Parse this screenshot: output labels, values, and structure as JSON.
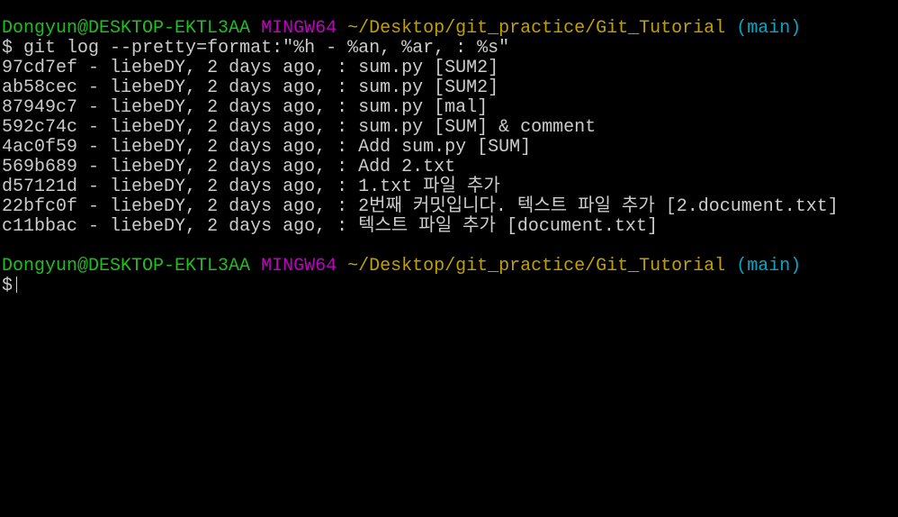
{
  "prompt": {
    "user_host": "Dongyun@DESKTOP-EKTL3AA",
    "system": "MINGW64",
    "path": "~/Desktop/git_practice/Git_Tutorial",
    "branch": "(main)",
    "symbol": "$"
  },
  "command": "git log --pretty=format:\"%h - %an, %ar, : %s\"",
  "log": [
    {
      "hash": "97cd7ef",
      "author": "liebeDY",
      "time": "2 days ago",
      "message": "sum.py [SUM2]"
    },
    {
      "hash": "ab58cec",
      "author": "liebeDY",
      "time": "2 days ago",
      "message": "sum.py [SUM2]"
    },
    {
      "hash": "87949c7",
      "author": "liebeDY",
      "time": "2 days ago",
      "message": "sum.py [mal]"
    },
    {
      "hash": "592c74c",
      "author": "liebeDY",
      "time": "2 days ago",
      "message": "sum.py [SUM] & comment"
    },
    {
      "hash": "4ac0f59",
      "author": "liebeDY",
      "time": "2 days ago",
      "message": "Add sum.py [SUM]"
    },
    {
      "hash": "569b689",
      "author": "liebeDY",
      "time": "2 days ago",
      "message": "Add 2.txt"
    },
    {
      "hash": "d57121d",
      "author": "liebeDY",
      "time": "2 days ago",
      "message": "1.txt 파일 추가"
    },
    {
      "hash": "22bfc0f",
      "author": "liebeDY",
      "time": "2 days ago",
      "message": "2번째 커밋입니다. 텍스트 파일 추가 [2.document.txt]"
    },
    {
      "hash": "c11bbac",
      "author": "liebeDY",
      "time": "2 days ago",
      "message": "텍스트 파일 추가 [document.txt]"
    }
  ],
  "colors": {
    "green": "#1ec01e",
    "magenta": "#c000c0",
    "yellow": "#c2a000",
    "cyan": "#00a8c8",
    "text": "#cccccc",
    "background": "#000000"
  }
}
